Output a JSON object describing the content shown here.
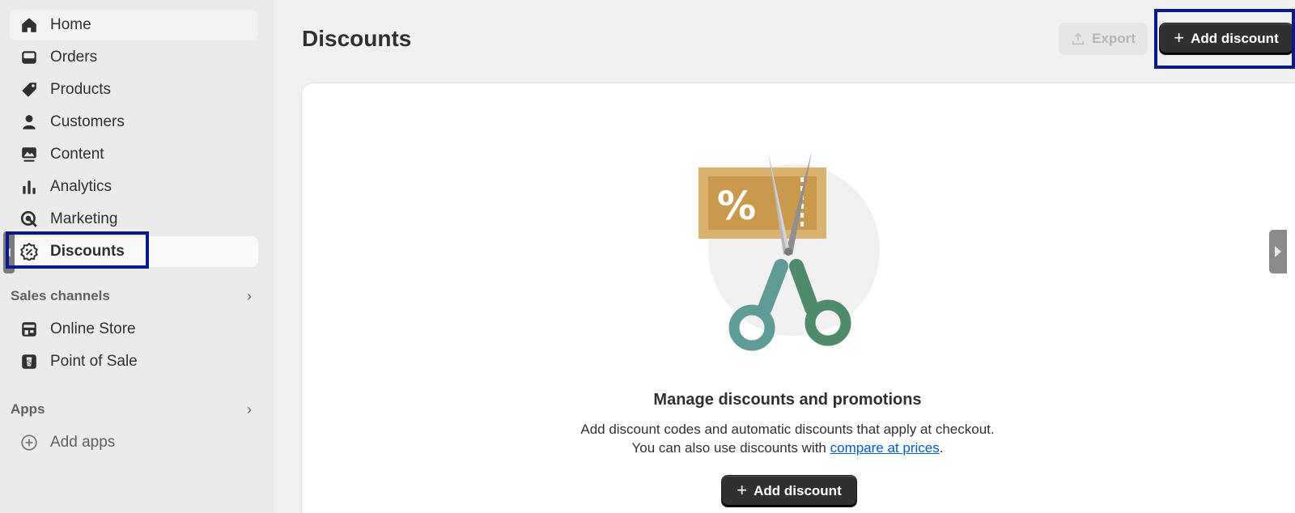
{
  "nav": {
    "items": [
      {
        "label": "Home",
        "icon": "home-icon"
      },
      {
        "label": "Orders",
        "icon": "inbox-icon"
      },
      {
        "label": "Products",
        "icon": "tag-icon"
      },
      {
        "label": "Customers",
        "icon": "person-icon"
      },
      {
        "label": "Content",
        "icon": "image-icon"
      },
      {
        "label": "Analytics",
        "icon": "bar-chart-icon"
      },
      {
        "label": "Marketing",
        "icon": "target-icon"
      },
      {
        "label": "Discounts",
        "icon": "discount-badge-icon"
      }
    ],
    "sales_channels": {
      "title": "Sales channels",
      "items": [
        {
          "label": "Online Store",
          "icon": "store-icon"
        },
        {
          "label": "Point of Sale",
          "icon": "pos-icon"
        }
      ]
    },
    "apps": {
      "title": "Apps",
      "items": [
        {
          "label": "Add apps",
          "icon": "plus-circle-icon"
        }
      ]
    }
  },
  "header": {
    "title": "Discounts",
    "export_label": "Export",
    "add_label": "Add discount"
  },
  "empty_state": {
    "heading": "Manage discounts and promotions",
    "line1": "Add discount codes and automatic discounts that apply at checkout.",
    "line2_prefix": "You can also use discounts with ",
    "line2_link": "compare at prices",
    "line2_suffix": ".",
    "button_label": "Add discount",
    "illustration_text": "%"
  },
  "colors": {
    "accent_dark": "#303030",
    "link": "#005bd3",
    "highlight": "#0a1a8c",
    "coupon": "#d9b26f",
    "scissors_teal": "#5f9c98",
    "scissors_green": "#4f8a6a"
  }
}
